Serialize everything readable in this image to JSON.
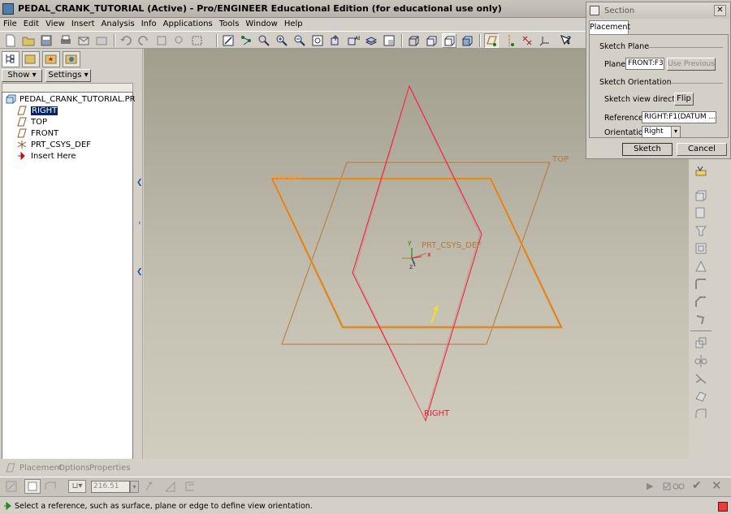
{
  "window": {
    "title": "PEDAL_CRANK_TUTORIAL (Active) - Pro/ENGINEER Educational Edition (for educational use only)"
  },
  "menu": [
    "File",
    "Edit",
    "View",
    "Insert",
    "Analysis",
    "Info",
    "Applications",
    "Tools",
    "Window",
    "Help"
  ],
  "left_panel": {
    "show_label": "Show",
    "settings_label": "Settings",
    "tree": [
      {
        "label": "PEDAL_CRANK_TUTORIAL.PRT",
        "icon": "part-icon"
      },
      {
        "label": "RIGHT",
        "icon": "datum-plane-icon",
        "selected": true
      },
      {
        "label": "TOP",
        "icon": "datum-plane-icon"
      },
      {
        "label": "FRONT",
        "icon": "datum-plane-icon"
      },
      {
        "label": "PRT_CSYS_DEF",
        "icon": "coordinate-system-icon"
      },
      {
        "label": "Insert Here",
        "icon": "insert-arrow-icon"
      }
    ]
  },
  "canvas": {
    "labels": {
      "front": "FRONT",
      "top": "TOP",
      "right": "RIGHT",
      "csys": "PRT_CSYS_DEF",
      "axis_y": "y",
      "axis_x": "x",
      "axis_z": "z"
    },
    "colors": {
      "right_plane": "#e0203a",
      "datum": "#b07a3a",
      "front_highlight": "#f0a040"
    }
  },
  "dialog": {
    "title": "Section",
    "tab": "Placement",
    "sketch_plane_group": "Sketch Plane",
    "plane_label": "Plane",
    "plane_value": "FRONT:F3",
    "use_previous": "Use Previous",
    "orientation_group": "Sketch Orientation",
    "view_dir_label": "Sketch view direction",
    "flip_label": "Flip",
    "reference_label": "Reference",
    "reference_value": "RIGHT:F1(DATUM ...",
    "orientation_label": "Orientation",
    "orientation_value": "Right",
    "sketch_button": "Sketch",
    "cancel_button": "Cancel"
  },
  "dashboard": {
    "tabs": [
      "Placement",
      "Options",
      "Properties"
    ],
    "thickness_value": "216.51"
  },
  "status": {
    "message": "Select a reference, such as surface, plane or edge to define view orientation."
  }
}
